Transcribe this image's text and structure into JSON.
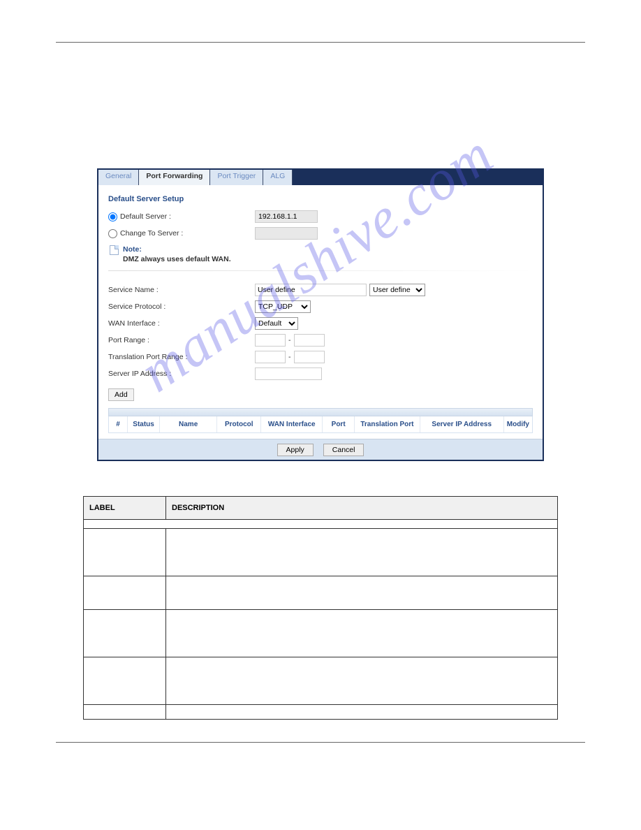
{
  "watermark": "manualshive.com",
  "tabs": {
    "general": "General",
    "port_forwarding": "Port Forwarding",
    "port_trigger": "Port Trigger",
    "alg": "ALG"
  },
  "section": {
    "title": "Default Server Setup",
    "default_server_label": "Default Server :",
    "default_server_value": "192.168.1.1",
    "change_to_server_label": "Change To Server :",
    "note_title": "Note:",
    "note_text": "DMZ always uses default WAN."
  },
  "form": {
    "service_name_label": "Service Name :",
    "service_name_value": "User define",
    "service_name_select": "User define",
    "service_protocol_label": "Service Protocol :",
    "service_protocol_value": "TCP_UDP",
    "wan_interface_label": "WAN Interface :",
    "wan_interface_value": "Default",
    "port_range_label": "Port Range :",
    "translation_port_range_label": "Translation Port Range :",
    "server_ip_label": "Server IP Address :",
    "add_label": "Add"
  },
  "grid": {
    "cols": {
      "idx": "#",
      "status": "Status",
      "name": "Name",
      "protocol": "Protocol",
      "wan": "WAN Interface",
      "port": "Port",
      "tport": "Translation Port",
      "ip": "Server IP Address",
      "modify": "Modify"
    }
  },
  "buttons": {
    "apply": "Apply",
    "cancel": "Cancel"
  },
  "desc_table": {
    "h1": "LABEL",
    "h2": "DESCRIPTION"
  }
}
